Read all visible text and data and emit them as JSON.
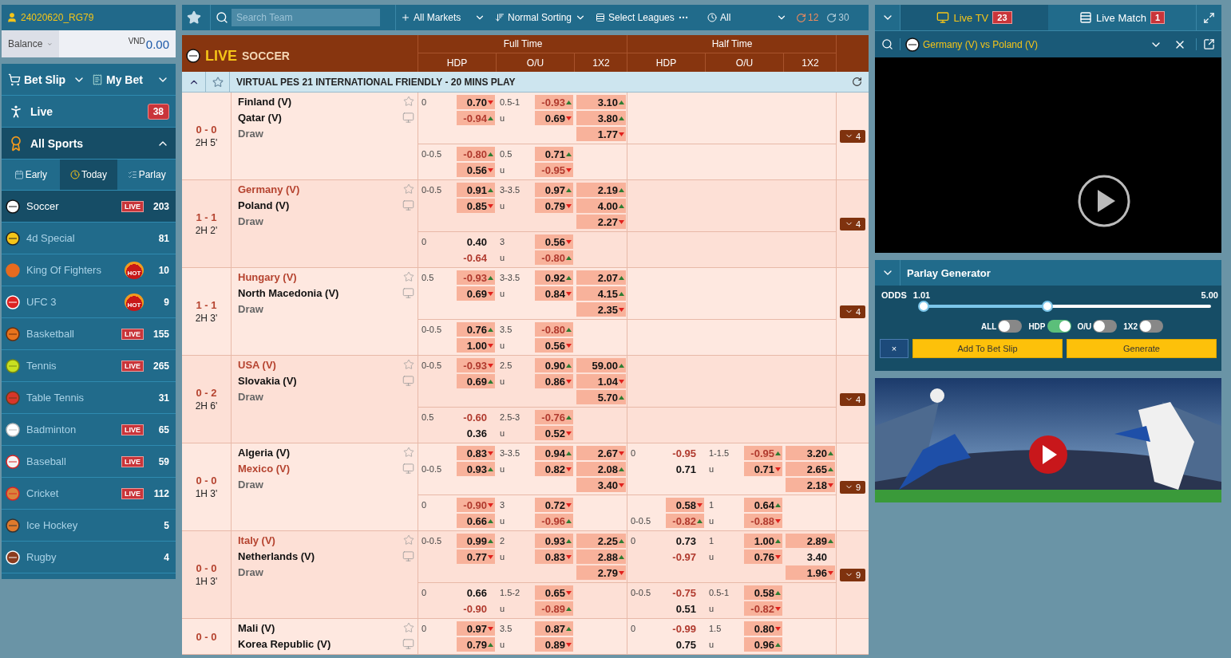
{
  "account": {
    "user": "24020620_RG79",
    "balance_label": "Balance",
    "currency": "VND",
    "balance": "0.00"
  },
  "nav": {
    "bet_slip": "Bet Slip",
    "my_bet": "My Bet",
    "live": "Live",
    "live_count": "38",
    "all_sports": "All Sports",
    "expanded": true
  },
  "day_tabs": [
    {
      "label": "Early",
      "selected": false
    },
    {
      "label": "Today",
      "selected": true
    },
    {
      "label": "Parlay",
      "selected": false
    }
  ],
  "sports": [
    {
      "name": "Soccer",
      "selected": true,
      "badge": {
        "kind": "live",
        "text": "LIVE"
      },
      "count": "203"
    },
    {
      "name": "4d Special",
      "selected": false,
      "count": "81"
    },
    {
      "name": "King Of Fighters",
      "selected": false,
      "badge": {
        "kind": "hot",
        "text": "HOT"
      },
      "count": "10"
    },
    {
      "name": "UFC 3",
      "selected": false,
      "badge": {
        "kind": "hot",
        "text": "HOT"
      },
      "count": "9"
    },
    {
      "name": "Basketball",
      "selected": false,
      "badge": {
        "kind": "live",
        "text": "LIVE"
      },
      "count": "155"
    },
    {
      "name": "Tennis",
      "selected": false,
      "badge": {
        "kind": "live",
        "text": "LIVE"
      },
      "count": "265"
    },
    {
      "name": "Table Tennis",
      "selected": false,
      "count": "31"
    },
    {
      "name": "Badminton",
      "selected": false,
      "badge": {
        "kind": "live",
        "text": "LIVE"
      },
      "count": "65"
    },
    {
      "name": "Baseball",
      "selected": false,
      "badge": {
        "kind": "live",
        "text": "LIVE"
      },
      "count": "59"
    },
    {
      "name": "Cricket",
      "selected": false,
      "badge": {
        "kind": "live",
        "text": "LIVE"
      },
      "count": "112"
    },
    {
      "name": "Ice Hockey",
      "selected": false,
      "count": "5"
    },
    {
      "name": "Rugby",
      "selected": false,
      "count": "4"
    }
  ],
  "toolbar": {
    "search_placeholder": "Search Team",
    "markets": "All Markets",
    "sorting": "Normal Sorting",
    "leagues": "Select Leagues",
    "period": "All",
    "refresh_live": "12",
    "refresh_all": "30"
  },
  "header": {
    "live": "LIVE",
    "sport": "SOCCER",
    "full_time": "Full Time",
    "half_time": "Half Time",
    "columns": [
      "HDP",
      "O/U",
      "1X2",
      "HDP",
      "O/U",
      "1X2"
    ]
  },
  "league": {
    "name": "VIRTUAL PES 21 INTERNATIONAL FRIENDLY - 20 MINS PLAY",
    "expanded": true
  },
  "matches": [
    {
      "score": "0 - 0",
      "period": "2H 5'",
      "home": {
        "name": "Finland (V)",
        "favorite": false
      },
      "away": {
        "name": "Qatar (V)",
        "favorite": false
      },
      "draw": "Draw",
      "more": "4",
      "lines": [
        {
          "ft": {
            "hdp": {
              "home": {
                "line": "0",
                "value": "0.70",
                "kind": "down"
              },
              "away": {
                "value": "-0.94",
                "kind": "up"
              }
            },
            "ou": {
              "line": "0.5-1",
              "under_label": "u",
              "over": {
                "value": "-0.93",
                "kind": "up"
              },
              "under": {
                "value": "0.69",
                "kind": "down"
              }
            },
            "x12": [
              {
                "value": "3.10",
                "kind": "up"
              },
              {
                "value": "3.80",
                "kind": "up"
              },
              {
                "value": "1.77",
                "kind": "down"
              }
            ]
          }
        },
        {
          "ft": {
            "hdp": {
              "home": {
                "line": "0-0.5",
                "value": "-0.80",
                "kind": "up"
              },
              "away": {
                "value": "0.56",
                "kind": "down"
              }
            },
            "ou": {
              "line": "0.5",
              "under_label": "u",
              "over": {
                "value": "0.71",
                "kind": "up"
              },
              "under": {
                "value": "-0.95",
                "kind": "down"
              }
            }
          }
        }
      ]
    },
    {
      "score": "1 - 1",
      "period": "2H 2'",
      "home": {
        "name": "Germany (V)",
        "favorite": true
      },
      "away": {
        "name": "Poland (V)",
        "favorite": false
      },
      "draw": "Draw",
      "more": "4",
      "lines": [
        {
          "ft": {
            "hdp": {
              "home": {
                "line": "0-0.5",
                "value": "0.91",
                "kind": "up"
              },
              "away": {
                "value": "0.85",
                "kind": "down"
              }
            },
            "ou": {
              "line": "3-3.5",
              "under_label": "u",
              "over": {
                "value": "0.97",
                "kind": "up"
              },
              "under": {
                "value": "0.79",
                "kind": "down"
              }
            },
            "x12": [
              {
                "value": "2.19",
                "kind": "up"
              },
              {
                "value": "4.00",
                "kind": "up"
              },
              {
                "value": "2.27",
                "kind": "down"
              }
            ]
          }
        },
        {
          "ft": {
            "hdp": {
              "home": {
                "line": "0",
                "value": "0.40",
                "kind": "plain"
              },
              "away": {
                "value": "-0.64",
                "kind": "plain"
              }
            },
            "ou": {
              "line": "3",
              "under_label": "u",
              "over": {
                "value": "0.56",
                "kind": "down"
              },
              "under": {
                "value": "-0.80",
                "kind": "up"
              }
            }
          }
        }
      ]
    },
    {
      "score": "1 - 1",
      "period": "2H 3'",
      "home": {
        "name": "Hungary (V)",
        "favorite": true
      },
      "away": {
        "name": "North Macedonia (V)",
        "favorite": false
      },
      "draw": "Draw",
      "more": "4",
      "lines": [
        {
          "ft": {
            "hdp": {
              "home": {
                "line": "0.5",
                "value": "-0.93",
                "kind": "up"
              },
              "away": {
                "value": "0.69",
                "kind": "down"
              }
            },
            "ou": {
              "line": "3-3.5",
              "under_label": "u",
              "over": {
                "value": "0.92",
                "kind": "up"
              },
              "under": {
                "value": "0.84",
                "kind": "down"
              }
            },
            "x12": [
              {
                "value": "2.07",
                "kind": "up"
              },
              {
                "value": "4.15",
                "kind": "up"
              },
              {
                "value": "2.35",
                "kind": "down"
              }
            ]
          }
        },
        {
          "ft": {
            "hdp": {
              "home": {
                "line": "0-0.5",
                "value": "0.76",
                "kind": "up"
              },
              "away": {
                "value": "1.00",
                "kind": "down"
              }
            },
            "ou": {
              "line": "3.5",
              "under_label": "u",
              "over": {
                "value": "-0.80",
                "kind": "up"
              },
              "under": {
                "value": "0.56",
                "kind": "down"
              }
            }
          }
        }
      ]
    },
    {
      "score": "0 - 2",
      "period": "2H 6'",
      "home": {
        "name": "USA (V)",
        "favorite": true
      },
      "away": {
        "name": "Slovakia (V)",
        "favorite": false
      },
      "draw": "Draw",
      "more": "4",
      "lines": [
        {
          "ft": {
            "hdp": {
              "home": {
                "line": "0-0.5",
                "value": "-0.93",
                "kind": "down"
              },
              "away": {
                "value": "0.69",
                "kind": "up"
              }
            },
            "ou": {
              "line": "2.5",
              "under_label": "u",
              "over": {
                "value": "0.90",
                "kind": "up"
              },
              "under": {
                "value": "0.86",
                "kind": "down"
              }
            },
            "x12": [
              {
                "value": "59.00",
                "kind": "up"
              },
              {
                "value": "1.04",
                "kind": "down"
              },
              {
                "value": "5.70",
                "kind": "up"
              }
            ]
          }
        },
        {
          "ft": {
            "hdp": {
              "home": {
                "line": "0.5",
                "value": "-0.60",
                "kind": "plain"
              },
              "away": {
                "value": "0.36",
                "kind": "plain"
              }
            },
            "ou": {
              "line": "2.5-3",
              "under_label": "u",
              "over": {
                "value": "-0.76",
                "kind": "up"
              },
              "under": {
                "value": "0.52",
                "kind": "down"
              }
            }
          }
        }
      ]
    },
    {
      "score": "0 - 0",
      "period": "1H 3'",
      "home": {
        "name": "Algeria (V)",
        "favorite": false
      },
      "away": {
        "name": "Mexico (V)",
        "favorite": true
      },
      "draw": "Draw",
      "more": "9",
      "lines": [
        {
          "ft": {
            "hdp": {
              "home": {
                "value": "0.83",
                "kind": "down"
              },
              "away": {
                "line": "0-0.5",
                "value": "0.93",
                "kind": "up"
              }
            },
            "ou": {
              "line": "3-3.5",
              "under_label": "u",
              "over": {
                "value": "0.94",
                "kind": "up"
              },
              "under": {
                "value": "0.82",
                "kind": "down"
              }
            },
            "x12": [
              {
                "value": "2.67",
                "kind": "down"
              },
              {
                "value": "2.08",
                "kind": "up"
              },
              {
                "value": "3.40",
                "kind": "down"
              }
            ]
          },
          "ht": {
            "hdp": {
              "home": {
                "line": "0",
                "value": "-0.95",
                "kind": "plain"
              },
              "away": {
                "value": "0.71",
                "kind": "plain"
              }
            },
            "ou": {
              "line": "1-1.5",
              "under_label": "u",
              "over": {
                "value": "-0.95",
                "kind": "up"
              },
              "under": {
                "value": "0.71",
                "kind": "down"
              }
            },
            "x12": [
              {
                "value": "3.20",
                "kind": "up"
              },
              {
                "value": "2.65",
                "kind": "up"
              },
              {
                "value": "2.18",
                "kind": "down"
              }
            ]
          }
        },
        {
          "ft": {
            "hdp": {
              "home": {
                "line": "0",
                "value": "-0.90",
                "kind": "down"
              },
              "away": {
                "value": "0.66",
                "kind": "up"
              }
            },
            "ou": {
              "line": "3",
              "under_label": "u",
              "over": {
                "value": "0.72",
                "kind": "down"
              },
              "under": {
                "value": "-0.96",
                "kind": "up"
              }
            }
          },
          "ht": {
            "hdp": {
              "home": {
                "value": "0.58",
                "kind": "down"
              },
              "away": {
                "line": "0-0.5",
                "value": "-0.82",
                "kind": "up"
              }
            },
            "ou": {
              "line": "1",
              "under_label": "u",
              "over": {
                "value": "0.64",
                "kind": "up"
              },
              "under": {
                "value": "-0.88",
                "kind": "down"
              }
            }
          }
        }
      ]
    },
    {
      "score": "0 - 0",
      "period": "1H 3'",
      "home": {
        "name": "Italy (V)",
        "favorite": true
      },
      "away": {
        "name": "Netherlands (V)",
        "favorite": false
      },
      "draw": "Draw",
      "more": "9",
      "lines": [
        {
          "ft": {
            "hdp": {
              "home": {
                "line": "0-0.5",
                "value": "0.99",
                "kind": "up"
              },
              "away": {
                "value": "0.77",
                "kind": "down"
              }
            },
            "ou": {
              "line": "2",
              "under_label": "u",
              "over": {
                "value": "0.93",
                "kind": "up"
              },
              "under": {
                "value": "0.83",
                "kind": "down"
              }
            },
            "x12": [
              {
                "value": "2.25",
                "kind": "up"
              },
              {
                "value": "2.88",
                "kind": "up"
              },
              {
                "value": "2.79",
                "kind": "down"
              }
            ]
          },
          "ht": {
            "hdp": {
              "home": {
                "line": "0",
                "value": "0.73",
                "kind": "plain"
              },
              "away": {
                "value": "-0.97",
                "kind": "plain"
              }
            },
            "ou": {
              "line": "1",
              "under_label": "u",
              "over": {
                "value": "1.00",
                "kind": "up"
              },
              "under": {
                "value": "0.76",
                "kind": "down"
              }
            },
            "x12": [
              {
                "value": "2.89",
                "kind": "up"
              },
              {
                "value": "3.40",
                "kind": "plain"
              },
              {
                "value": "1.96",
                "kind": "down"
              }
            ]
          }
        },
        {
          "ft": {
            "hdp": {
              "home": {
                "line": "0",
                "value": "0.66",
                "kind": "plain"
              },
              "away": {
                "value": "-0.90",
                "kind": "plain"
              }
            },
            "ou": {
              "line": "1.5-2",
              "under_label": "u",
              "over": {
                "value": "0.65",
                "kind": "down"
              },
              "under": {
                "value": "-0.89",
                "kind": "up"
              }
            }
          },
          "ht": {
            "hdp": {
              "home": {
                "line": "0-0.5",
                "value": "-0.75",
                "kind": "plain"
              },
              "away": {
                "value": "0.51",
                "kind": "plain"
              }
            },
            "ou": {
              "line": "0.5-1",
              "under_label": "u",
              "over": {
                "value": "0.58",
                "kind": "up"
              },
              "under": {
                "value": "-0.82",
                "kind": "down"
              }
            }
          }
        }
      ]
    },
    {
      "score": "0 - 0",
      "home": {
        "name": "Mali (V)",
        "favorite": false
      },
      "away": {
        "name": "Korea Republic (V)",
        "favorite": false
      },
      "lines": [
        {
          "ft": {
            "hdp": {
              "home": {
                "line": "0",
                "value": "0.97",
                "kind": "down"
              },
              "away": {
                "value": "0.79",
                "kind": "up"
              }
            },
            "ou": {
              "line": "3.5",
              "under_label": "u",
              "over": {
                "value": "0.87",
                "kind": "up"
              },
              "under": {
                "value": "0.89",
                "kind": "down"
              }
            }
          },
          "ht": {
            "hdp": {
              "home": {
                "line": "0",
                "value": "-0.99",
                "kind": "plain"
              },
              "away": {
                "value": "0.75",
                "kind": "plain"
              }
            },
            "ou": {
              "line": "1.5",
              "under_label": "u",
              "over": {
                "value": "0.80",
                "kind": "down"
              },
              "under": {
                "value": "0.96",
                "kind": "up"
              }
            }
          }
        }
      ]
    }
  ],
  "tv": {
    "tabs": [
      {
        "label": "Live TV",
        "count": "23",
        "selected": true
      },
      {
        "label": "Live Match",
        "count": "1",
        "selected": false
      }
    ],
    "match": "Germany (V) vs Poland (V)"
  },
  "parlay": {
    "title": "Parlay Generator",
    "expanded": true,
    "odds_label": "ODDS",
    "min": "1.01",
    "max": "5.00",
    "slider": {
      "thumbs": [
        {
          "level": 0.0
        },
        {
          "level": 0.43
        }
      ]
    },
    "toggles": [
      {
        "label": "ALL",
        "on": false
      },
      {
        "label": "HDP",
        "on": true
      },
      {
        "label": "O/U",
        "on": false
      },
      {
        "label": "1X2",
        "on": false
      }
    ],
    "buttons": [
      {
        "kind": "clear",
        "label": "×"
      },
      {
        "kind": "add",
        "label": "Add To Bet Slip"
      },
      {
        "kind": "generate",
        "label": "Generate"
      }
    ]
  }
}
